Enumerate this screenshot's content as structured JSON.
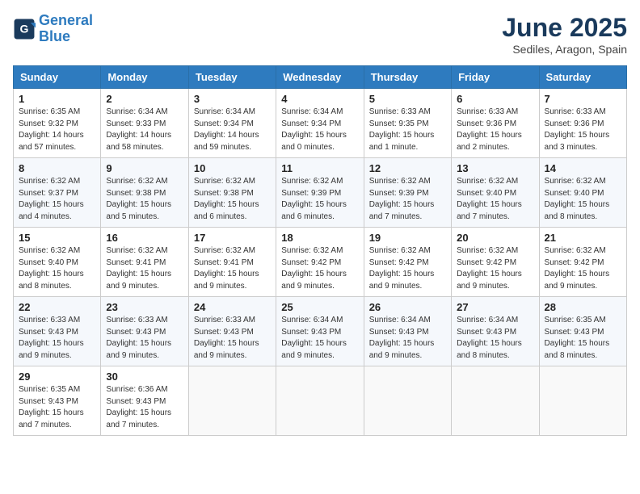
{
  "header": {
    "logo_line1": "General",
    "logo_line2": "Blue",
    "month": "June 2025",
    "location": "Sediles, Aragon, Spain"
  },
  "weekdays": [
    "Sunday",
    "Monday",
    "Tuesday",
    "Wednesday",
    "Thursday",
    "Friday",
    "Saturday"
  ],
  "weeks": [
    [
      {
        "day": "1",
        "sunrise": "6:35 AM",
        "sunset": "9:32 PM",
        "daylight": "14 hours and 57 minutes."
      },
      {
        "day": "2",
        "sunrise": "6:34 AM",
        "sunset": "9:33 PM",
        "daylight": "14 hours and 58 minutes."
      },
      {
        "day": "3",
        "sunrise": "6:34 AM",
        "sunset": "9:34 PM",
        "daylight": "14 hours and 59 minutes."
      },
      {
        "day": "4",
        "sunrise": "6:34 AM",
        "sunset": "9:34 PM",
        "daylight": "15 hours and 0 minutes."
      },
      {
        "day": "5",
        "sunrise": "6:33 AM",
        "sunset": "9:35 PM",
        "daylight": "15 hours and 1 minute."
      },
      {
        "day": "6",
        "sunrise": "6:33 AM",
        "sunset": "9:36 PM",
        "daylight": "15 hours and 2 minutes."
      },
      {
        "day": "7",
        "sunrise": "6:33 AM",
        "sunset": "9:36 PM",
        "daylight": "15 hours and 3 minutes."
      }
    ],
    [
      {
        "day": "8",
        "sunrise": "6:32 AM",
        "sunset": "9:37 PM",
        "daylight": "15 hours and 4 minutes."
      },
      {
        "day": "9",
        "sunrise": "6:32 AM",
        "sunset": "9:38 PM",
        "daylight": "15 hours and 5 minutes."
      },
      {
        "day": "10",
        "sunrise": "6:32 AM",
        "sunset": "9:38 PM",
        "daylight": "15 hours and 6 minutes."
      },
      {
        "day": "11",
        "sunrise": "6:32 AM",
        "sunset": "9:39 PM",
        "daylight": "15 hours and 6 minutes."
      },
      {
        "day": "12",
        "sunrise": "6:32 AM",
        "sunset": "9:39 PM",
        "daylight": "15 hours and 7 minutes."
      },
      {
        "day": "13",
        "sunrise": "6:32 AM",
        "sunset": "9:40 PM",
        "daylight": "15 hours and 7 minutes."
      },
      {
        "day": "14",
        "sunrise": "6:32 AM",
        "sunset": "9:40 PM",
        "daylight": "15 hours and 8 minutes."
      }
    ],
    [
      {
        "day": "15",
        "sunrise": "6:32 AM",
        "sunset": "9:40 PM",
        "daylight": "15 hours and 8 minutes."
      },
      {
        "day": "16",
        "sunrise": "6:32 AM",
        "sunset": "9:41 PM",
        "daylight": "15 hours and 9 minutes."
      },
      {
        "day": "17",
        "sunrise": "6:32 AM",
        "sunset": "9:41 PM",
        "daylight": "15 hours and 9 minutes."
      },
      {
        "day": "18",
        "sunrise": "6:32 AM",
        "sunset": "9:42 PM",
        "daylight": "15 hours and 9 minutes."
      },
      {
        "day": "19",
        "sunrise": "6:32 AM",
        "sunset": "9:42 PM",
        "daylight": "15 hours and 9 minutes."
      },
      {
        "day": "20",
        "sunrise": "6:32 AM",
        "sunset": "9:42 PM",
        "daylight": "15 hours and 9 minutes."
      },
      {
        "day": "21",
        "sunrise": "6:32 AM",
        "sunset": "9:42 PM",
        "daylight": "15 hours and 9 minutes."
      }
    ],
    [
      {
        "day": "22",
        "sunrise": "6:33 AM",
        "sunset": "9:43 PM",
        "daylight": "15 hours and 9 minutes."
      },
      {
        "day": "23",
        "sunrise": "6:33 AM",
        "sunset": "9:43 PM",
        "daylight": "15 hours and 9 minutes."
      },
      {
        "day": "24",
        "sunrise": "6:33 AM",
        "sunset": "9:43 PM",
        "daylight": "15 hours and 9 minutes."
      },
      {
        "day": "25",
        "sunrise": "6:34 AM",
        "sunset": "9:43 PM",
        "daylight": "15 hours and 9 minutes."
      },
      {
        "day": "26",
        "sunrise": "6:34 AM",
        "sunset": "9:43 PM",
        "daylight": "15 hours and 9 minutes."
      },
      {
        "day": "27",
        "sunrise": "6:34 AM",
        "sunset": "9:43 PM",
        "daylight": "15 hours and 8 minutes."
      },
      {
        "day": "28",
        "sunrise": "6:35 AM",
        "sunset": "9:43 PM",
        "daylight": "15 hours and 8 minutes."
      }
    ],
    [
      {
        "day": "29",
        "sunrise": "6:35 AM",
        "sunset": "9:43 PM",
        "daylight": "15 hours and 7 minutes."
      },
      {
        "day": "30",
        "sunrise": "6:36 AM",
        "sunset": "9:43 PM",
        "daylight": "15 hours and 7 minutes."
      },
      null,
      null,
      null,
      null,
      null
    ]
  ]
}
